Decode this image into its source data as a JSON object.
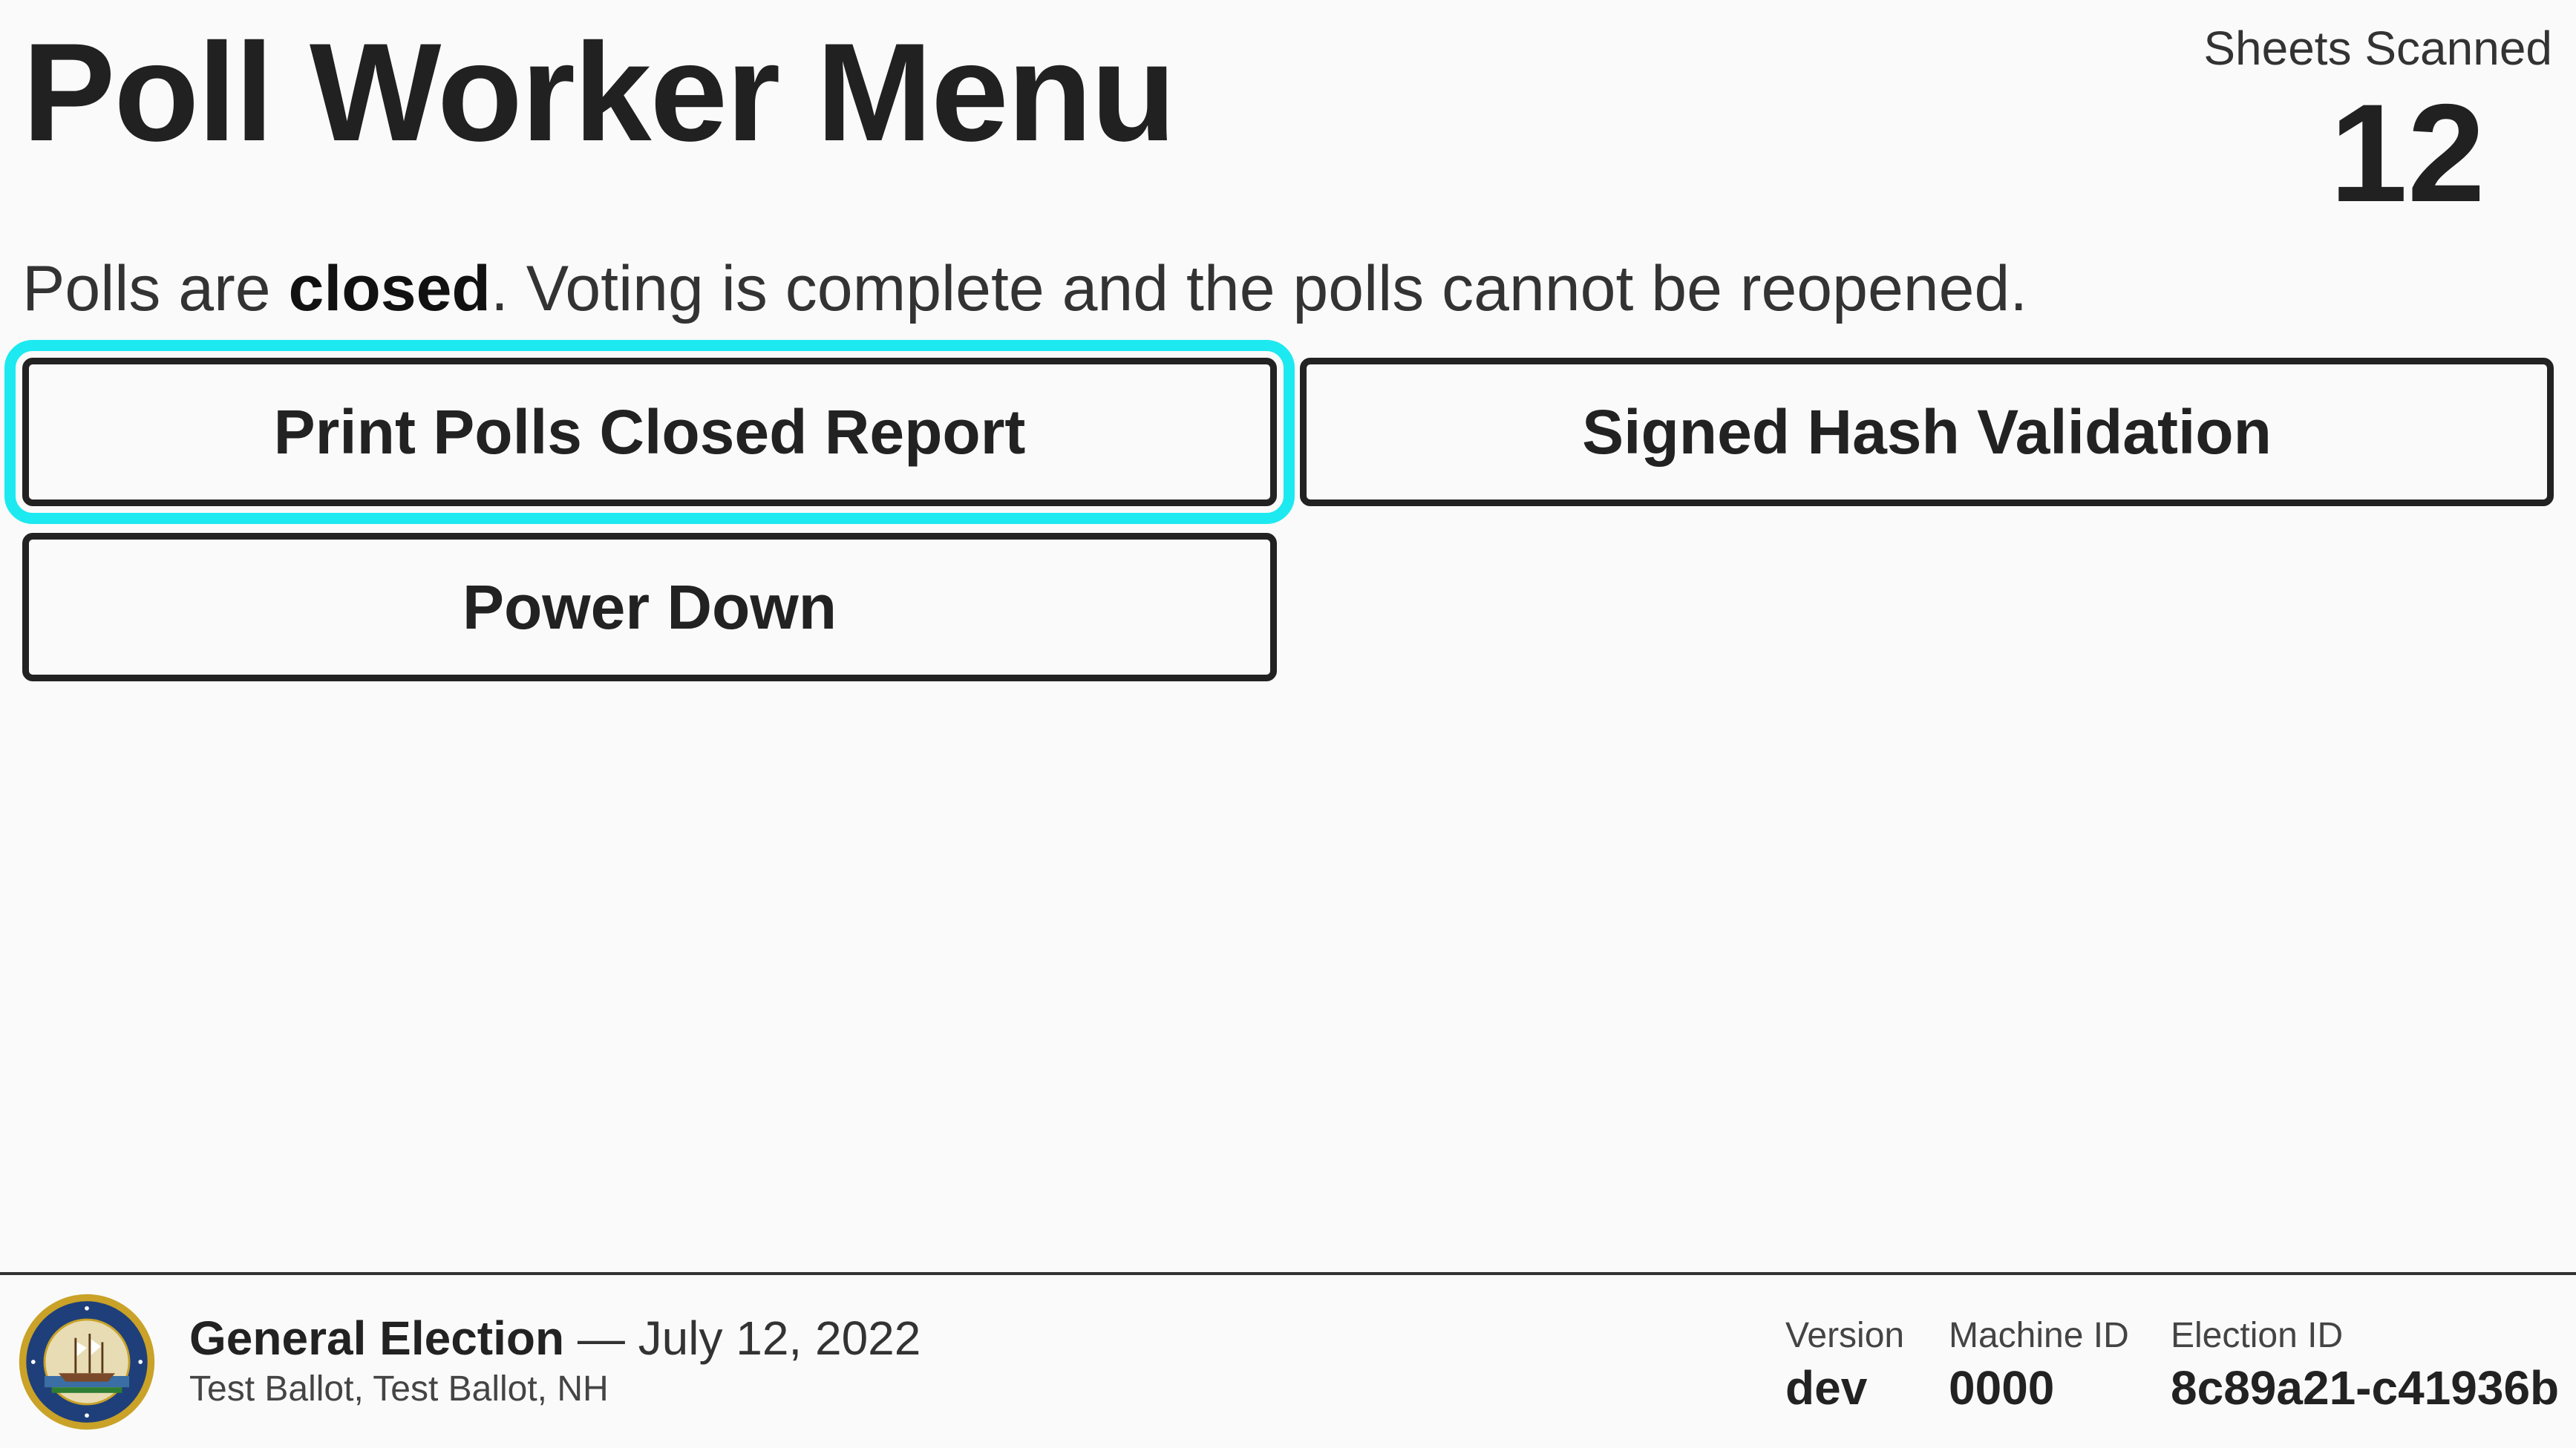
{
  "header": {
    "title": "Poll Worker Menu",
    "sheets_scanned_label": "Sheets Scanned",
    "sheets_scanned_value": "12"
  },
  "status": {
    "prefix": "Polls are ",
    "state": "closed",
    "suffix": ". Voting is complete and the polls cannot be reopened."
  },
  "actions": {
    "print_report": "Print Polls Closed Report",
    "signed_hash": "Signed Hash Validation",
    "power_down": "Power Down"
  },
  "footer": {
    "seal_icon": "state-seal-icon",
    "election_title": "General Election",
    "election_separator": " — ",
    "election_date": "July 12, 2022",
    "ballot_info": "Test Ballot, Test Ballot, NH",
    "version_label": "Version",
    "version_value": "dev",
    "machine_label": "Machine ID",
    "machine_value": "0000",
    "election_id_label": "Election ID",
    "election_id_value": "8c89a21-c41936b"
  },
  "colors": {
    "focus_outline": "#1de9f0",
    "button_border": "#222222",
    "background": "#fafafa"
  }
}
